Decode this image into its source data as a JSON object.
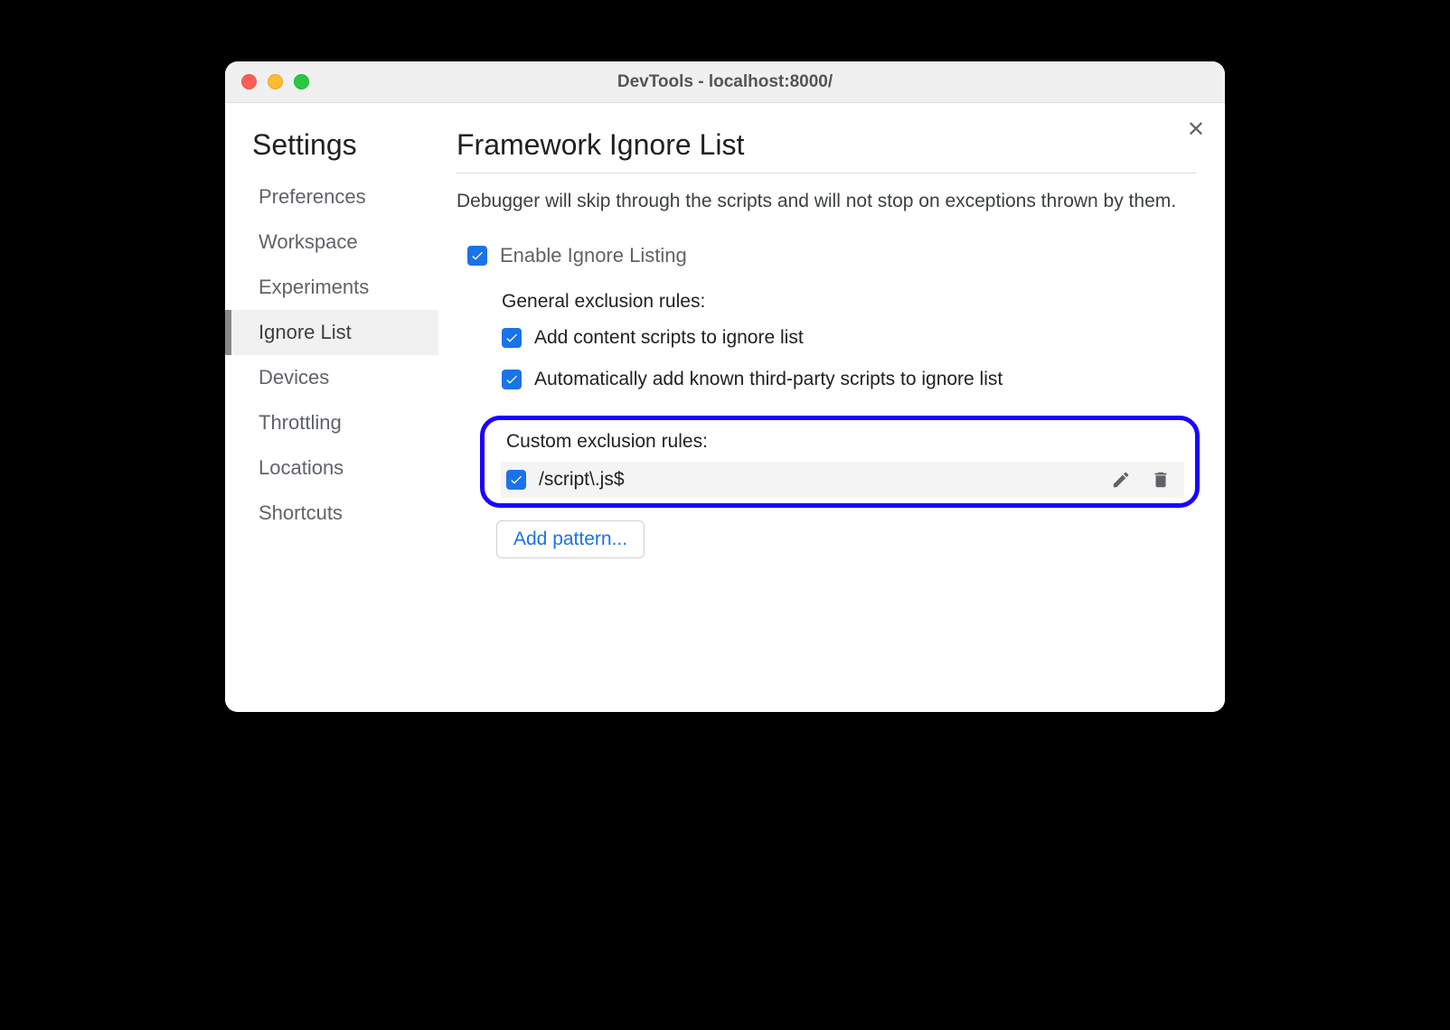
{
  "window": {
    "title": "DevTools - localhost:8000/"
  },
  "sidebar": {
    "title": "Settings",
    "items": [
      {
        "label": "Preferences"
      },
      {
        "label": "Workspace"
      },
      {
        "label": "Experiments"
      },
      {
        "label": "Ignore List",
        "active": true
      },
      {
        "label": "Devices"
      },
      {
        "label": "Throttling"
      },
      {
        "label": "Locations"
      },
      {
        "label": "Shortcuts"
      }
    ]
  },
  "main": {
    "title": "Framework Ignore List",
    "description": "Debugger will skip through the scripts and will not stop on exceptions thrown by them.",
    "enable_label": "Enable Ignore Listing",
    "general_section": {
      "heading": "General exclusion rules:",
      "rule_content_scripts": "Add content scripts to ignore list",
      "rule_third_party": "Automatically add known third-party scripts to ignore list"
    },
    "custom_section": {
      "heading": "Custom exclusion rules:",
      "rules": [
        {
          "pattern": "/script\\.js$",
          "checked": true
        }
      ]
    },
    "add_pattern_label": "Add pattern..."
  }
}
